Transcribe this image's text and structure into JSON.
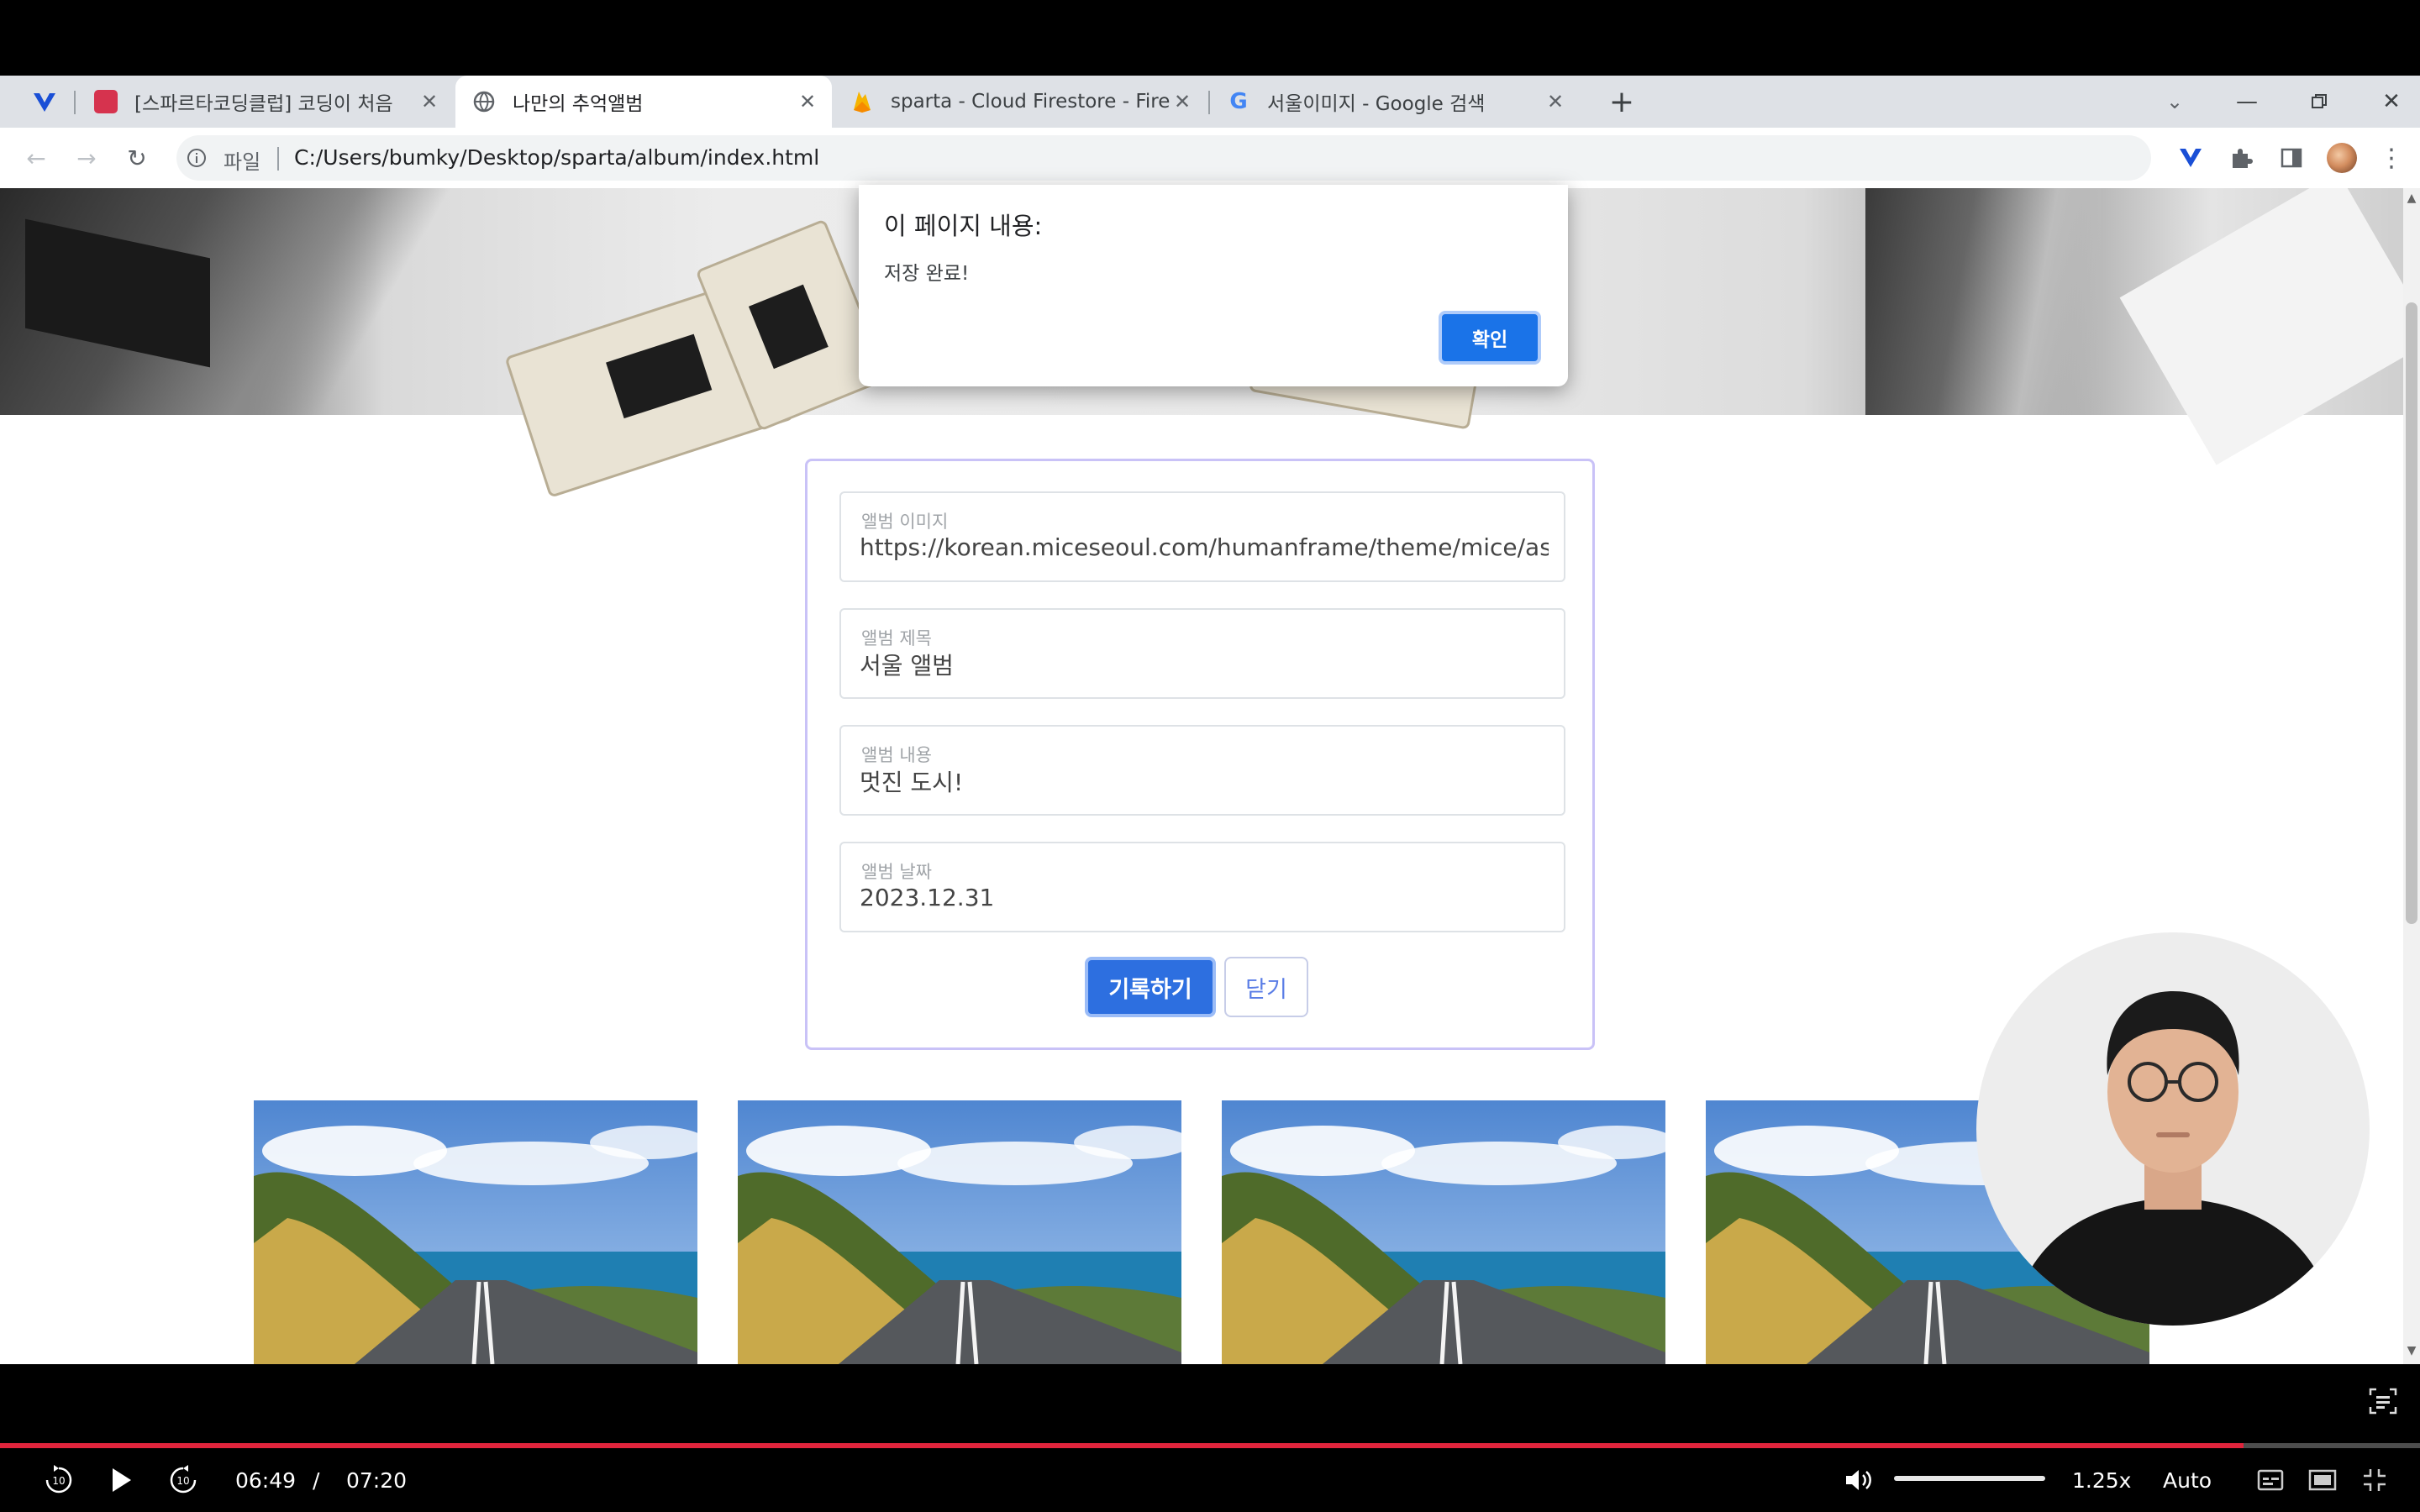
{
  "browser": {
    "tabs": [
      {
        "title": "[스파르타코딩클럽] 코딩이 처음",
        "active": false,
        "favicon_color": "#d6334e"
      },
      {
        "title": "나만의 추억앨범",
        "active": true,
        "favicon_color": "#5f6368"
      },
      {
        "title": "sparta - Cloud Firestore - Fireb",
        "active": false,
        "favicon_color": "#f6b400"
      },
      {
        "title": "서울이미지 - Google 검색",
        "active": false,
        "favicon_color": "#4285f4"
      }
    ],
    "new_tab_icon": "plus-icon",
    "address": {
      "scheme_label": "파일",
      "url": "C:/Users/bumky/Desktop/sparta/album/index.html"
    }
  },
  "alert": {
    "title": "이 페이지 내용:",
    "message": "저장 완료!",
    "ok_label": "확인"
  },
  "form": {
    "fields": [
      {
        "label": "앨범 이미지",
        "value": "https://korean.miceseoul.com/humanframe/theme/mice/assets"
      },
      {
        "label": "앨범 제목",
        "value": "서울 앨범"
      },
      {
        "label": "앨범 내용",
        "value": "멋진 도시!"
      },
      {
        "label": "앨범 날짜",
        "value": "2023.12.31"
      }
    ],
    "save_label": "기록하기",
    "close_label": "닫기"
  },
  "player": {
    "current_time": "06:49",
    "separator": "/",
    "duration": "07:20",
    "progress": 0.927,
    "speed": "1.25x",
    "quality": "Auto",
    "rewind_seconds": "10",
    "forward_seconds": "10"
  },
  "colors": {
    "accent": "#2d6fe0",
    "progress": "#e0243c",
    "form_border": "#c9c2f7"
  }
}
